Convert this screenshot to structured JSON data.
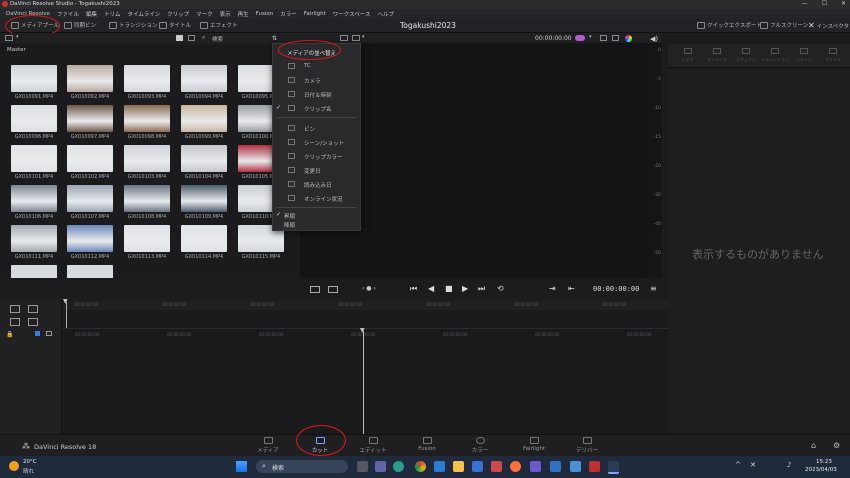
{
  "window": {
    "title": "DaVinci Resolve Studio - Togakushi2023",
    "controls": [
      "—",
      "☐",
      "✕"
    ]
  },
  "menu": [
    "DaVinci Resolve",
    "ファイル",
    "編集",
    "トリム",
    "タイムライン",
    "クリップ",
    "マーク",
    "表示",
    "再生",
    "Fusion",
    "カラー",
    "Fairlight",
    "ワークスペース",
    "ヘルプ"
  ],
  "toolbar": {
    "media_pool": "メディアプール",
    "sync_bin": "同期ビン",
    "transition": "トランジション",
    "title": "タイトル",
    "effect": "エフェクト",
    "project_title": "Togakushi2023",
    "quick_export": "クイックエクスポート",
    "fullscreen": "フルスクリーン",
    "inspector": "インスペクタ"
  },
  "media_pool_header": {
    "search": "検索"
  },
  "master_label": "Master",
  "clips": [
    "GX010091.MP4",
    "GX010092.MP4",
    "GX010093.MP4",
    "GX010094.MP4",
    "GX010095.MP4",
    "GX010096.MP4",
    "GX010097.MP4",
    "GX010098.MP4",
    "GX010099.MP4",
    "GX010100.MP4",
    "GX010101.MP4",
    "GX010102.MP4",
    "GX010103.MP4",
    "GX010104.MP4",
    "GX010105.MP4",
    "GX010106.MP4",
    "GX010107.MP4",
    "GX010108.MP4",
    "GX010109.MP4",
    "GX010110.MP4",
    "GX010111.MP4",
    "GX010112.MP4",
    "GX010113.MP4",
    "GX010114.MP4",
    "GX010115.MP4"
  ],
  "thumb_colors": [
    "#cfd3d8",
    "#b8a8a0",
    "#d6d9dd",
    "#c9ccd2",
    "#dadde0",
    "#dde0e3",
    "#6e5a48",
    "#8a6c52",
    "#c9b7a0",
    "#9a9da4",
    "#e0e2e5",
    "#dfe2e4",
    "#cfd2d6",
    "#c4c7cc",
    "#b03040",
    "#7d858f",
    "#9aa4b2",
    "#6a7482",
    "#4f5d6c",
    "#c8ccd2",
    "#a4a8ae",
    "#6a88b8",
    "#dfe2e6",
    "#e0e3e6",
    "#d4d8dc"
  ],
  "dropdown": {
    "header": "メディアの並べ替え",
    "items": [
      {
        "label": "TC",
        "checked": false
      },
      {
        "label": "カメラ",
        "checked": false
      },
      {
        "label": "日付＆時刻",
        "checked": false
      },
      {
        "label": "クリップ名",
        "checked": true
      },
      {
        "label": "ビン",
        "checked": false
      },
      {
        "label": "シーン/ショット",
        "checked": false
      },
      {
        "label": "クリップカラー",
        "checked": false
      },
      {
        "label": "変更日",
        "checked": false
      },
      {
        "label": "読み込み日",
        "checked": false
      },
      {
        "label": "オンライン状況",
        "checked": false
      }
    ],
    "order": [
      {
        "label": "昇順",
        "checked": true
      },
      {
        "label": "降順",
        "checked": false
      }
    ]
  },
  "viewer": {
    "timecode_top": "00:00:00:00",
    "timecode": "00:00:00:00"
  },
  "meter_ticks": [
    "0",
    "-5",
    "-10",
    "-15",
    "-20",
    "-30",
    "-40",
    "-50"
  ],
  "right_tabs": [
    "ビデオ",
    "オーディオ",
    "エフェクト",
    "トランジション",
    "イメージ",
    "ファイル"
  ],
  "empty_message": "表示するものがありません",
  "timeline": {
    "ruler_top": [
      "00:00:00:00",
      "00:00:00:00",
      "00:00:00:00",
      "00:00:00:00",
      "00:00:00:00",
      "00:00:00:00",
      "00:00:00:00"
    ],
    "ruler_bottom": [
      "00:00:00:00",
      "00:00:00:00",
      "00:00:00:00",
      "00:00:00:00",
      "00:00:00:00",
      "00:00:00:00",
      "00:00:00:00"
    ]
  },
  "pages": [
    "メディア",
    "カット",
    "エディット",
    "Fusion",
    "カラー",
    "Fairlight",
    "デリバー"
  ],
  "brand": "DaVinci Resolve 18",
  "taskbar": {
    "weather_temp": "20°C",
    "weather_desc": "晴れ",
    "search": "検索",
    "time": "15:23",
    "date": "2023/04/03"
  },
  "colors": {
    "accent_red": "#e01818",
    "bg": "#1c1c1e",
    "taskbar": "#1f2b3d"
  }
}
